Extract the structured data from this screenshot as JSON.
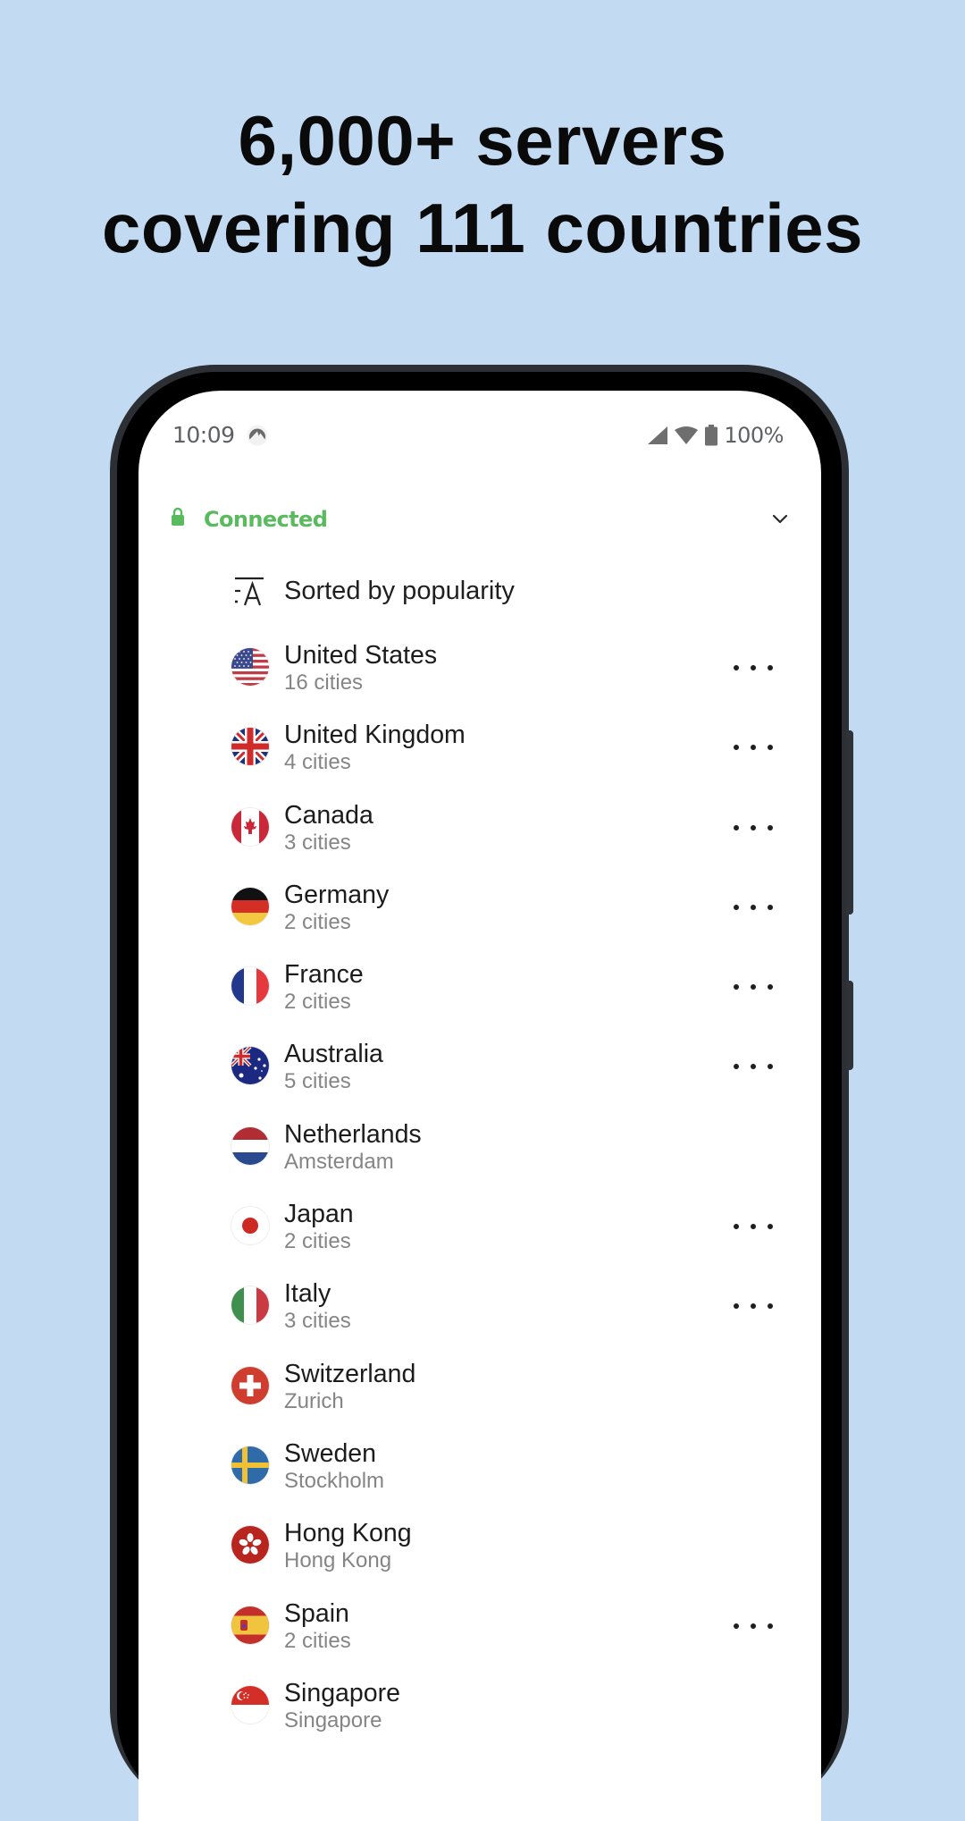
{
  "headline": {
    "line1": "6,000+ servers",
    "line2": "covering 111 countries"
  },
  "status_bar": {
    "time": "10:09",
    "notification_icon": "nordvpn-logo-icon",
    "battery": "100%",
    "icons": [
      "signal-icon",
      "wifi-icon",
      "battery-icon"
    ]
  },
  "connection": {
    "status": "Connected",
    "color": "#59ba5e",
    "icon": "lock-icon",
    "expand_icon": "chevron-down-icon"
  },
  "sort": {
    "label": "Sorted by popularity",
    "icon": "sort-icon"
  },
  "countries": [
    {
      "name": "United States",
      "sub": "16 cities",
      "flag": "us",
      "has_menu": true
    },
    {
      "name": "United Kingdom",
      "sub": "4 cities",
      "flag": "gb",
      "has_menu": true
    },
    {
      "name": "Canada",
      "sub": "3 cities",
      "flag": "ca",
      "has_menu": true
    },
    {
      "name": "Germany",
      "sub": "2 cities",
      "flag": "de",
      "has_menu": true
    },
    {
      "name": "France",
      "sub": "2 cities",
      "flag": "fr",
      "has_menu": true
    },
    {
      "name": "Australia",
      "sub": "5 cities",
      "flag": "au",
      "has_menu": true
    },
    {
      "name": "Netherlands",
      "sub": "Amsterdam",
      "flag": "nl",
      "has_menu": false
    },
    {
      "name": "Japan",
      "sub": "2 cities",
      "flag": "jp",
      "has_menu": true
    },
    {
      "name": "Italy",
      "sub": "3 cities",
      "flag": "it",
      "has_menu": true
    },
    {
      "name": "Switzerland",
      "sub": "Zurich",
      "flag": "ch",
      "has_menu": false
    },
    {
      "name": "Sweden",
      "sub": "Stockholm",
      "flag": "se",
      "has_menu": false
    },
    {
      "name": "Hong Kong",
      "sub": "Hong Kong",
      "flag": "hk",
      "has_menu": false
    },
    {
      "name": "Spain",
      "sub": "2 cities",
      "flag": "es",
      "has_menu": true
    },
    {
      "name": "Singapore",
      "sub": "Singapore",
      "flag": "sg",
      "has_menu": false
    }
  ]
}
